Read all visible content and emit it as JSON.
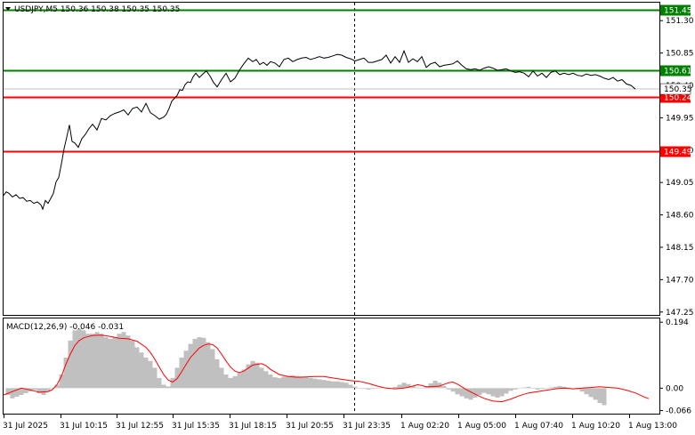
{
  "chart_data": {
    "type": "line",
    "title": "USDJPY,M5  150.36 150.38 150.35 150.35",
    "symbol_label": "USDJPY,M5",
    "ohlc_label": "150.36 150.38 150.35 150.35",
    "current_price": "150.35",
    "price_axis_ticks": [
      "151.30",
      "150.85",
      "150.40",
      "149.95",
      "149.50",
      "149.05",
      "148.60",
      "148.15",
      "147.70",
      "147.25"
    ],
    "time_labels": [
      "31 Jul 2025",
      "31 Jul 10:15",
      "31 Jul 12:55",
      "31 Jul 15:35",
      "31 Jul 18:15",
      "31 Jul 20:55",
      "31 Jul 23:35",
      "1 Aug 02:20",
      "1 Aug 05:00",
      "1 Aug 07:40",
      "1 Aug 10:20",
      "1 Aug 13:00"
    ],
    "ylim": [
      147.21,
      151.55
    ],
    "levels": [
      {
        "price": 151.45,
        "label": "151.45",
        "color": "#008000"
      },
      {
        "price": 150.61,
        "label": "150.61",
        "color": "#008000"
      },
      {
        "price": 150.24,
        "label": "150.24",
        "color": "#ff0000"
      },
      {
        "price": 149.49,
        "label": "149.49",
        "color": "#ff0000"
      }
    ],
    "price_series": {
      "x": [
        0,
        3,
        6,
        10,
        14,
        18,
        22,
        26,
        30,
        34,
        38,
        42,
        44,
        47,
        50,
        53,
        56,
        59,
        62,
        65,
        68,
        71,
        74,
        77,
        80,
        84,
        88,
        92,
        96,
        100,
        105,
        110,
        115,
        120,
        125,
        130,
        135,
        140,
        145,
        150,
        155,
        160,
        165,
        170,
        175,
        180,
        183,
        186,
        189,
        192,
        195,
        198,
        201,
        204,
        207,
        210,
        213,
        216,
        220,
        224,
        228,
        232,
        236,
        240,
        245,
        250,
        255,
        260,
        265,
        270,
        275,
        280,
        284,
        288,
        292,
        296,
        300,
        305,
        310,
        315,
        320,
        325,
        330,
        335,
        340,
        345,
        350,
        355,
        360,
        365,
        370,
        375,
        380,
        385,
        390,
        395,
        400,
        405,
        410,
        415,
        420,
        425,
        430,
        435,
        440,
        445,
        450,
        455,
        460,
        465,
        470,
        475,
        480,
        485,
        490,
        495,
        500,
        505,
        510,
        515,
        520,
        525,
        530,
        535,
        540,
        545,
        550,
        555,
        560,
        565,
        570,
        575,
        580,
        585,
        590,
        595,
        600,
        605,
        610,
        615,
        620,
        625,
        630,
        635,
        640,
        645,
        650,
        655,
        660,
        665,
        670,
        675,
        680,
        685,
        690,
        695,
        700,
        705,
        710,
        715,
        720,
        725,
        728
      ],
      "y": [
        148.87,
        148.92,
        148.9,
        148.85,
        148.88,
        148.83,
        148.84,
        148.79,
        148.8,
        148.76,
        148.78,
        148.74,
        148.68,
        148.8,
        148.76,
        148.83,
        148.9,
        149.06,
        149.12,
        149.31,
        149.52,
        149.68,
        149.85,
        149.62,
        149.6,
        149.54,
        149.66,
        149.72,
        149.8,
        149.86,
        149.78,
        149.94,
        149.92,
        149.98,
        150.01,
        150.03,
        150.06,
        149.99,
        150.08,
        150.1,
        150.03,
        150.15,
        150.02,
        149.98,
        149.93,
        149.96,
        150.0,
        150.08,
        150.18,
        150.22,
        150.26,
        150.34,
        150.33,
        150.41,
        150.45,
        150.44,
        150.52,
        150.57,
        150.51,
        150.56,
        150.6,
        150.53,
        150.44,
        150.38,
        150.48,
        150.57,
        150.45,
        150.5,
        150.61,
        150.7,
        150.78,
        150.73,
        150.76,
        150.69,
        150.72,
        150.68,
        150.73,
        150.71,
        150.66,
        150.76,
        150.78,
        150.73,
        150.76,
        150.78,
        150.79,
        150.76,
        150.78,
        150.8,
        150.78,
        150.79,
        150.81,
        150.83,
        150.82,
        150.79,
        150.77,
        150.74,
        150.76,
        150.78,
        150.72,
        150.72,
        150.74,
        150.76,
        150.82,
        150.71,
        150.8,
        150.72,
        150.88,
        150.72,
        150.77,
        150.73,
        150.8,
        150.65,
        150.7,
        150.72,
        150.66,
        150.68,
        150.69,
        150.7,
        150.74,
        150.68,
        150.63,
        150.62,
        150.63,
        150.61,
        150.64,
        150.66,
        150.64,
        150.61,
        150.62,
        150.63,
        150.6,
        150.58,
        150.59,
        150.57,
        150.52,
        150.6,
        150.53,
        150.57,
        150.51,
        150.58,
        150.6,
        150.55,
        150.57,
        150.55,
        150.57,
        150.54,
        150.53,
        150.56,
        150.54,
        150.55,
        150.53,
        150.5,
        150.48,
        150.51,
        150.46,
        150.48,
        150.42,
        150.4,
        150.35
      ]
    },
    "macd": {
      "label": "MACD(12,26,9) -0.046 -0.031",
      "params": "12,26,9",
      "main_value": "-0.046",
      "signal_value": "-0.031",
      "axis_ticks": [
        "0.194",
        "0.00",
        "-0.066"
      ],
      "ylim": [
        -0.075,
        0.205
      ],
      "histogram_x": [
        5,
        10,
        15,
        20,
        25,
        30,
        35,
        40,
        45,
        50,
        55,
        60,
        65,
        70,
        75,
        80,
        85,
        90,
        95,
        100,
        105,
        110,
        115,
        120,
        125,
        130,
        135,
        140,
        145,
        150,
        155,
        160,
        165,
        170,
        175,
        180,
        185,
        190,
        195,
        200,
        205,
        210,
        215,
        220,
        225,
        230,
        235,
        240,
        245,
        250,
        255,
        260,
        265,
        270,
        275,
        280,
        285,
        290,
        295,
        300,
        305,
        310,
        315,
        320,
        325,
        330,
        335,
        340,
        345,
        350,
        355,
        360,
        365,
        370,
        375,
        380,
        385,
        390,
        395,
        400,
        405,
        410,
        415,
        420,
        425,
        430,
        435,
        440,
        445,
        450,
        455,
        460,
        465,
        470,
        475,
        480,
        485,
        490,
        495,
        500,
        505,
        510,
        515,
        520,
        525,
        530,
        535,
        540,
        545,
        550,
        555,
        560,
        565,
        570,
        575,
        580,
        585,
        590,
        595,
        600,
        605,
        610,
        615,
        620,
        625,
        630,
        635,
        640,
        645,
        650,
        655,
        660,
        665,
        670,
        675,
        680,
        685,
        690,
        695,
        700,
        705,
        710,
        715,
        720,
        725
      ],
      "histogram": [
        -0.02,
        -0.03,
        -0.025,
        -0.02,
        -0.015,
        -0.01,
        -0.005,
        -0.015,
        -0.02,
        -0.01,
        0.0,
        0.01,
        0.04,
        0.09,
        0.14,
        0.17,
        0.175,
        0.17,
        0.16,
        0.16,
        0.165,
        0.16,
        0.15,
        0.145,
        0.15,
        0.16,
        0.165,
        0.155,
        0.14,
        0.12,
        0.105,
        0.09,
        0.08,
        0.06,
        0.03,
        0.01,
        0.005,
        0.03,
        0.06,
        0.09,
        0.11,
        0.13,
        0.145,
        0.15,
        0.148,
        0.135,
        0.115,
        0.085,
        0.06,
        0.04,
        0.03,
        0.035,
        0.045,
        0.055,
        0.07,
        0.08,
        0.075,
        0.06,
        0.05,
        0.04,
        0.032,
        0.03,
        0.034,
        0.036,
        0.038,
        0.036,
        0.034,
        0.032,
        0.03,
        0.028,
        0.026,
        0.024,
        0.022,
        0.02,
        0.02,
        0.018,
        0.016,
        0.01,
        0.004,
        0.0,
        -0.002,
        -0.004,
        -0.002,
        0.0,
        0.002,
        0.002,
        0.0,
        0.004,
        0.01,
        0.016,
        0.012,
        0.006,
        0.002,
        0.0,
        0.006,
        0.014,
        0.022,
        0.016,
        0.006,
        -0.004,
        -0.01,
        -0.018,
        -0.024,
        -0.03,
        -0.034,
        -0.028,
        -0.02,
        -0.014,
        -0.018,
        -0.024,
        -0.028,
        -0.024,
        -0.016,
        -0.008,
        -0.004,
        0.0,
        0.002,
        0.004,
        0.0,
        -0.004,
        -0.002,
        0.0,
        0.002,
        0.004,
        0.006,
        0.004,
        0.002,
        0.0,
        -0.004,
        -0.01,
        -0.018,
        -0.026,
        -0.034,
        -0.044,
        -0.05
      ],
      "signal_x": [
        0,
        10,
        20,
        30,
        40,
        50,
        55,
        60,
        65,
        70,
        75,
        80,
        85,
        90,
        95,
        100,
        110,
        120,
        130,
        140,
        150,
        160,
        165,
        170,
        175,
        180,
        185,
        190,
        195,
        200,
        210,
        220,
        225,
        230,
        235,
        240,
        245,
        250,
        255,
        260,
        265,
        270,
        280,
        290,
        295,
        300,
        310,
        320,
        330,
        340,
        350,
        360,
        370,
        380,
        390,
        400,
        410,
        420,
        430,
        440,
        450,
        460,
        465,
        470,
        475,
        480,
        490,
        500,
        505,
        510,
        515,
        520,
        530,
        540,
        550,
        560,
        570,
        580,
        590,
        600,
        610,
        620,
        630,
        640,
        650,
        660,
        670,
        680,
        690,
        700,
        710,
        720,
        725
      ],
      "signal": [
        -0.02,
        -0.01,
        0.0,
        -0.005,
        -0.012,
        -0.01,
        -0.004,
        0.01,
        0.035,
        0.07,
        0.1,
        0.125,
        0.14,
        0.148,
        0.152,
        0.155,
        0.156,
        0.152,
        0.147,
        0.145,
        0.138,
        0.12,
        0.105,
        0.085,
        0.062,
        0.04,
        0.024,
        0.018,
        0.028,
        0.048,
        0.09,
        0.118,
        0.126,
        0.13,
        0.128,
        0.118,
        0.1,
        0.08,
        0.062,
        0.05,
        0.046,
        0.05,
        0.068,
        0.072,
        0.066,
        0.055,
        0.04,
        0.034,
        0.032,
        0.033,
        0.034,
        0.034,
        0.03,
        0.026,
        0.022,
        0.02,
        0.014,
        0.006,
        0.0,
        -0.002,
        0.0,
        0.006,
        0.01,
        0.008,
        0.004,
        0.004,
        0.006,
        0.016,
        0.018,
        0.012,
        0.004,
        -0.004,
        -0.018,
        -0.03,
        -0.038,
        -0.04,
        -0.032,
        -0.022,
        -0.014,
        -0.01,
        -0.006,
        -0.002,
        0.0,
        -0.002,
        0.0,
        0.002,
        0.004,
        0.002,
        0.0,
        -0.006,
        -0.014,
        -0.026,
        -0.031
      ]
    }
  },
  "colors": {
    "price_line": "#000000",
    "macd_histogram": "#c0c0c0",
    "signal_line": "#ff0000",
    "support_green": "#008000",
    "resistance_red": "#ff0000",
    "current_price_box": "#ffffff"
  }
}
